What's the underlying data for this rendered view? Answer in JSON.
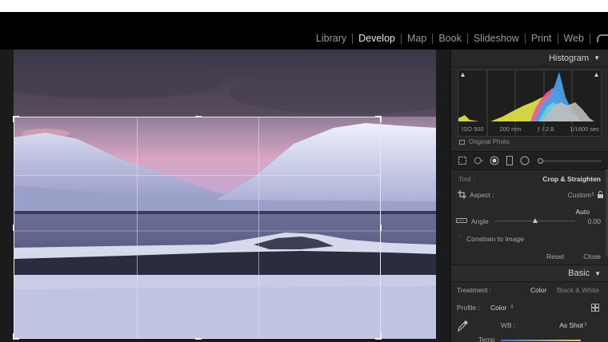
{
  "modules": [
    {
      "label": "Library",
      "active": false
    },
    {
      "label": "Develop",
      "active": true
    },
    {
      "label": "Map",
      "active": false
    },
    {
      "label": "Book",
      "active": false
    },
    {
      "label": "Slideshow",
      "active": false
    },
    {
      "label": "Print",
      "active": false
    },
    {
      "label": "Web",
      "active": false
    }
  ],
  "histogram": {
    "title": "Histogram",
    "iso": "ISO 500",
    "focal": "200 mm",
    "aperture": "ƒ / 2.8",
    "shutter": "1/1600 sec",
    "original_photo": "Original Photo"
  },
  "crop_panel": {
    "tool_label": "Tool :",
    "tool_value": "Crop & Straighten",
    "aspect_label": "Aspect :",
    "aspect_value": "Custom",
    "auto_label": "Auto",
    "angle_label": "Angle",
    "angle_value": "0.00",
    "angle_level": 0.5,
    "constrain_label": "Constrain to Image",
    "reset_label": "Reset",
    "close_label": "Close"
  },
  "basic": {
    "title": "Basic",
    "treatment_label": "Treatment :",
    "treatment_color": "Color",
    "treatment_bw": "Black & White",
    "profile_label": "Profile :",
    "profile_value": "Color",
    "wb_label": "WB :",
    "wb_value": "As Shot",
    "temp_label": "Temp"
  },
  "icons": {
    "panel_collapse": "triangle-down-icon",
    "logo": "lightroom-logo-icon"
  }
}
